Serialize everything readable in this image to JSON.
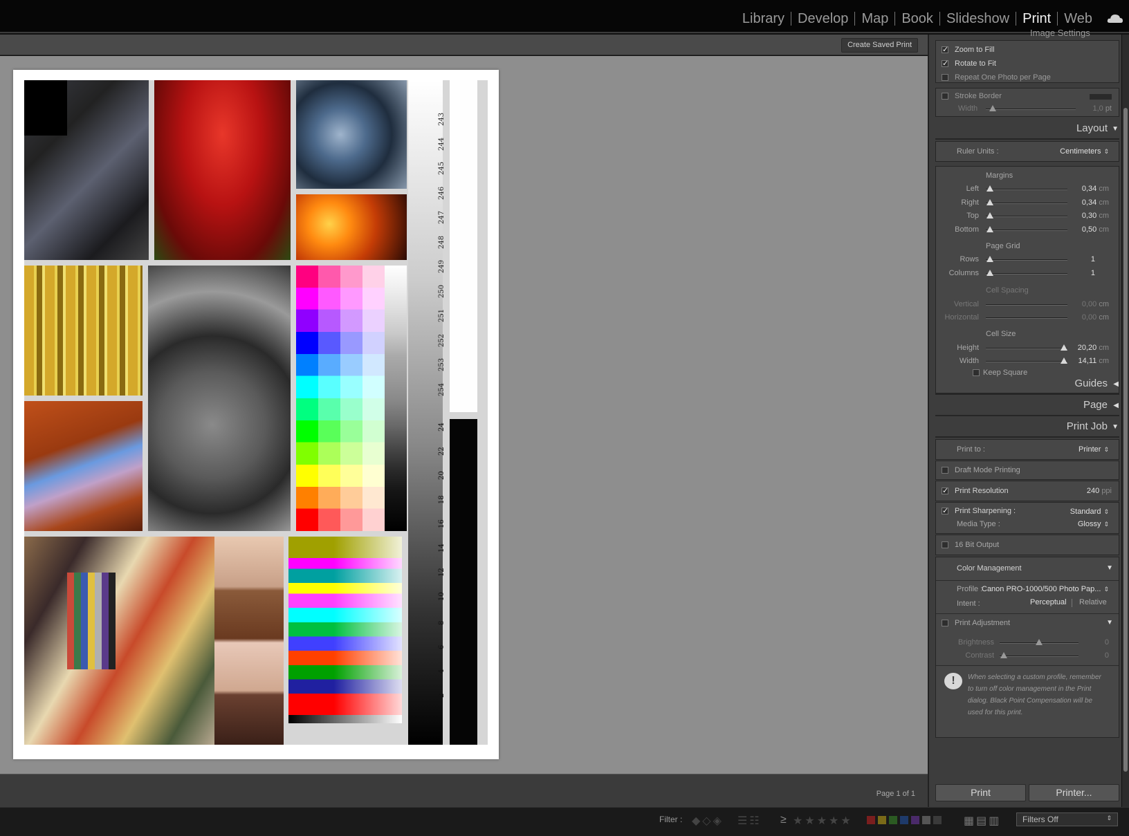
{
  "modules": [
    "Library",
    "Develop",
    "Map",
    "Book",
    "Slideshow",
    "Print",
    "Web"
  ],
  "active_module": "Print",
  "toolbar": {
    "create_saved_print": "Create Saved Print"
  },
  "canvas": {
    "page_count": "Page 1 of 1",
    "target_numbers_top": [
      "243",
      "244",
      "245",
      "246",
      "247",
      "248",
      "249",
      "250",
      "251",
      "252",
      "253",
      "254"
    ],
    "target_numbers_bottom": [
      "24",
      "22",
      "20",
      "18",
      "16",
      "14",
      "12",
      "10",
      "8",
      "6",
      "4",
      "2"
    ]
  },
  "image_settings": {
    "title": "Image Settings",
    "zoom_to_fill": {
      "label": "Zoom to Fill",
      "checked": true
    },
    "rotate_to_fit": {
      "label": "Rotate to Fit",
      "checked": true
    },
    "repeat_one": {
      "label": "Repeat One Photo per Page",
      "checked": false
    },
    "stroke_border": {
      "label": "Stroke Border",
      "checked": false
    },
    "width_label": "Width",
    "width_value": "1,0",
    "width_unit": "pt"
  },
  "layout": {
    "title": "Layout",
    "ruler_units_label": "Ruler Units :",
    "ruler_units_value": "Centimeters",
    "margins_title": "Margins",
    "margins": [
      {
        "label": "Left",
        "value": "0,34",
        "unit": "cm"
      },
      {
        "label": "Right",
        "value": "0,34",
        "unit": "cm"
      },
      {
        "label": "Top",
        "value": "0,30",
        "unit": "cm"
      },
      {
        "label": "Bottom",
        "value": "0,50",
        "unit": "cm"
      }
    ],
    "page_grid_title": "Page Grid",
    "rows_label": "Rows",
    "rows_value": "1",
    "columns_label": "Columns",
    "columns_value": "1",
    "cell_spacing_title": "Cell Spacing",
    "vertical_label": "Vertical",
    "vertical_value": "0,00",
    "vertical_unit": "cm",
    "horizontal_label": "Horizontal",
    "horizontal_value": "0,00",
    "horizontal_unit": "cm",
    "cell_size_title": "Cell Size",
    "height_label": "Height",
    "height_value": "20,20",
    "height_unit": "cm",
    "width_label": "Width",
    "width_value": "14,11",
    "width_unit": "cm",
    "keep_square": {
      "label": "Keep Square",
      "checked": false
    }
  },
  "guides": {
    "title": "Guides"
  },
  "page_section": {
    "title": "Page"
  },
  "print_job": {
    "title": "Print Job",
    "print_to_label": "Print to :",
    "print_to_value": "Printer",
    "draft_mode": {
      "label": "Draft Mode Printing",
      "checked": false
    },
    "print_resolution": {
      "label": "Print Resolution",
      "checked": true,
      "value": "240",
      "unit": "ppi"
    },
    "print_sharpening": {
      "label": "Print Sharpening :",
      "checked": true,
      "value": "Standard"
    },
    "media_type_label": "Media Type :",
    "media_type_value": "Glossy",
    "bit16": {
      "label": "16 Bit Output",
      "checked": false
    },
    "color_management_title": "Color Management",
    "profile_label": "Profile :",
    "profile_value": "Canon PRO-1000/500 Photo Pap...",
    "intent_label": "Intent :",
    "intent_perceptual": "Perceptual",
    "intent_relative": "Relative",
    "print_adjustment": {
      "label": "Print Adjustment",
      "checked": false
    },
    "brightness_label": "Brightness",
    "brightness_value": "0",
    "contrast_label": "Contrast",
    "contrast_value": "0",
    "notice": "When selecting a custom profile, remember to turn off color management in the Print dialog. Black Point Compensation will be used for this print."
  },
  "buttons": {
    "print": "Print",
    "printer": "Printer..."
  },
  "filmstrip": {
    "filter_label": "Filter :",
    "rating_operator": "≥",
    "filters_value": "Filters Off",
    "color_labels": [
      "#7a1e1e",
      "#7a6a18",
      "#2b5a22",
      "#1e3a6a",
      "#4a2a6a",
      "#555555",
      "#3a3a3a"
    ]
  }
}
